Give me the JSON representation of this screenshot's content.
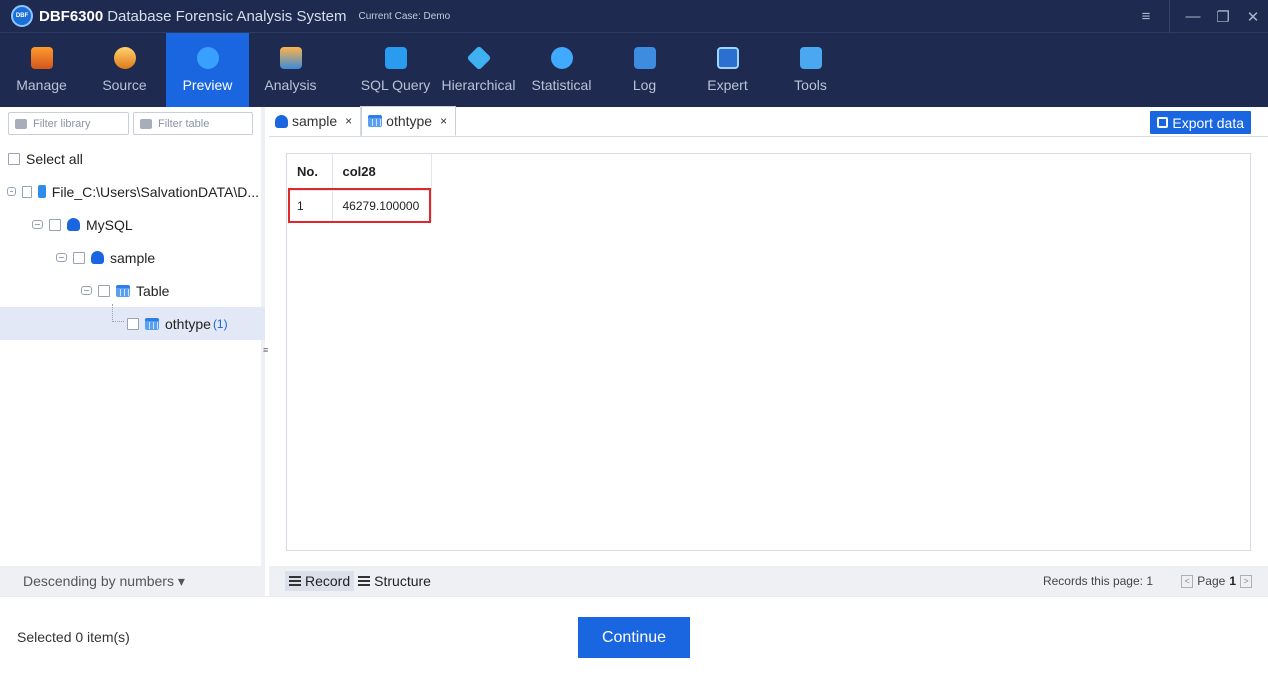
{
  "app": {
    "logo_text": "DBF",
    "name": "DBF6300",
    "subtitle": "Database Forensic Analysis System",
    "case": "Current Case: Demo"
  },
  "window_controls": {
    "menu": "≡",
    "minimize": "—",
    "restore": "❐",
    "close": "✕"
  },
  "toolbar": [
    {
      "label": "Manage",
      "icon": "manage-icon"
    },
    {
      "label": "Source",
      "icon": "source-icon"
    },
    {
      "label": "Preview",
      "icon": "preview-icon",
      "active": true
    },
    {
      "label": "Analysis",
      "icon": "analysis-icon"
    },
    {
      "label": "SQL Query",
      "icon": "sql-query-icon"
    },
    {
      "label": "Hierarchical",
      "icon": "hierarchical-icon"
    },
    {
      "label": "Statistical",
      "icon": "statistical-icon"
    },
    {
      "label": "Log",
      "icon": "log-icon"
    },
    {
      "label": "Expert",
      "icon": "expert-icon"
    },
    {
      "label": "Tools",
      "icon": "tools-icon"
    }
  ],
  "filters": {
    "library": "Filter library",
    "table": "Filter table"
  },
  "tree": {
    "select_all": "Select all",
    "file": "File_C:\\Users\\SalvationDATA\\D...",
    "mysql": "MySQL",
    "sample": "sample",
    "table": "Table",
    "othtype": "othtype",
    "othtype_count": "(1)"
  },
  "sort_label": "Descending by numbers ▾",
  "tabs": [
    {
      "label": "sample",
      "close": "×"
    },
    {
      "label": "othtype",
      "close": "×",
      "active": true
    }
  ],
  "export_label": "Export data",
  "grid": {
    "columns": [
      "No.",
      "col28"
    ],
    "rows": [
      [
        "1",
        "46279.100000"
      ]
    ]
  },
  "views": {
    "record": "Record",
    "structure": "Structure"
  },
  "records_this_page": "Records this page: 1",
  "pager": {
    "prev": "<",
    "page_label": "Page",
    "page": "1",
    "next": ">"
  },
  "selected_label": "Selected 0 item(s)",
  "continue_label": "Continue",
  "colors": {
    "titlebar": "#1e2a4f",
    "accent": "#1a66e0",
    "highlight": "#e0282c"
  }
}
